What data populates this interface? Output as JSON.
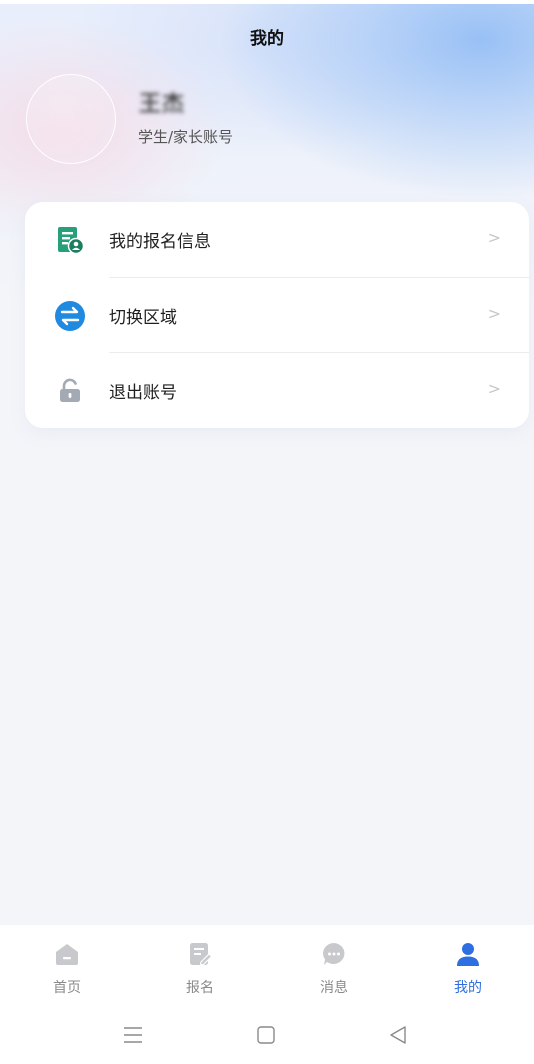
{
  "header": {
    "title": "我的"
  },
  "profile": {
    "name": "王杰",
    "account_type": "学生/家长账号"
  },
  "menu": {
    "items": [
      {
        "label": "我的报名信息",
        "icon": "registration-info-icon",
        "icon_color": "#27a07a"
      },
      {
        "label": "切换区域",
        "icon": "switch-region-icon",
        "icon_color": "#1f8ae0"
      },
      {
        "label": "退出账号",
        "icon": "unlock-icon",
        "icon_color": "#a3aab3"
      }
    ],
    "chevron": ">"
  },
  "tabbar": {
    "tabs": [
      {
        "label": "首页",
        "icon": "home-icon",
        "active": false
      },
      {
        "label": "报名",
        "icon": "form-edit-icon",
        "active": false
      },
      {
        "label": "消息",
        "icon": "message-bubble-icon",
        "active": false
      },
      {
        "label": "我的",
        "icon": "user-icon",
        "active": true
      }
    ],
    "inactive_color": "#c7c9cc",
    "active_color": "#2f6ee0"
  },
  "system_nav": {
    "buttons": [
      "menu-icon",
      "home-square-icon",
      "back-triangle-icon"
    ]
  }
}
